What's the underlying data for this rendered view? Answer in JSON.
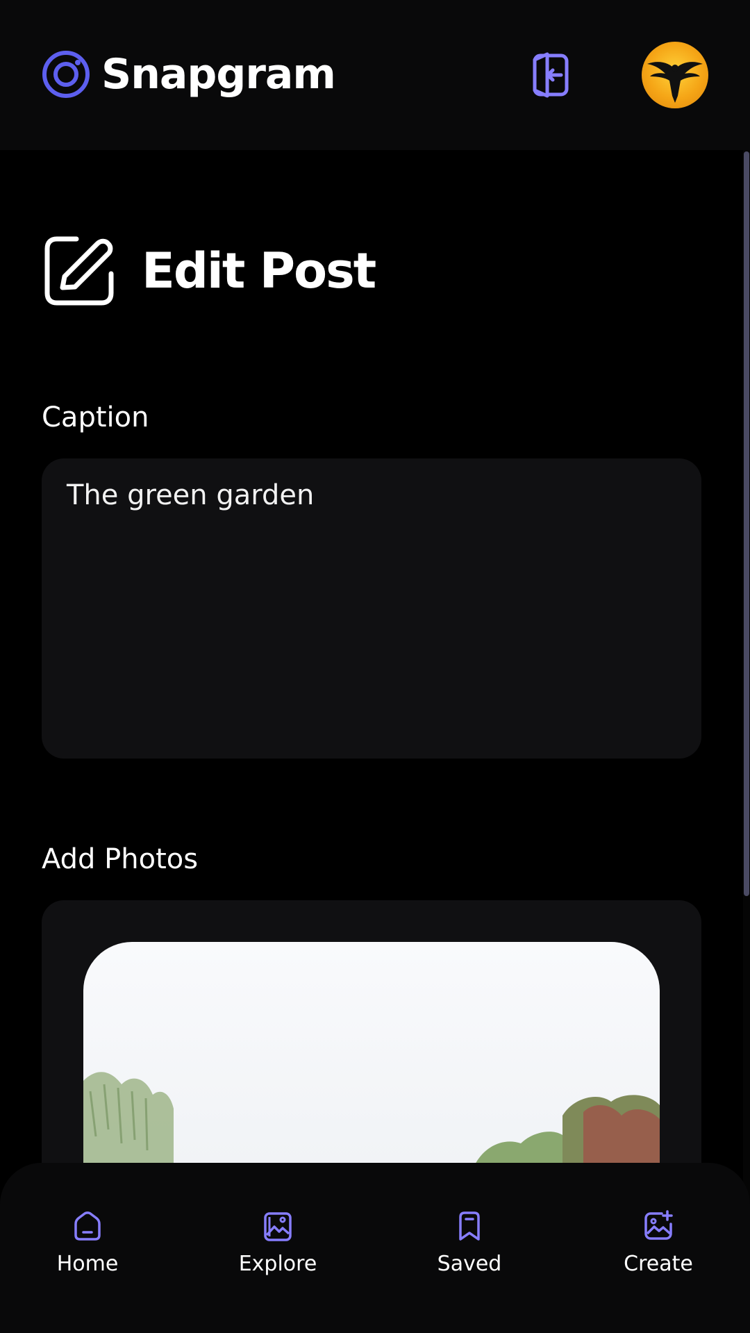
{
  "app": {
    "name": "Snapgram"
  },
  "header": {
    "logout_icon": "logout-icon",
    "avatar_icon": "eagle-avatar"
  },
  "page": {
    "title": "Edit Post",
    "title_icon": "edit-icon"
  },
  "form": {
    "caption_label": "Caption",
    "caption_value": "The green garden",
    "photos_label": "Add Photos"
  },
  "bottom_nav": [
    {
      "label": "Home",
      "icon": "home-icon"
    },
    {
      "label": "Explore",
      "icon": "explore-icon"
    },
    {
      "label": "Saved",
      "icon": "bookmark-icon"
    },
    {
      "label": "Create",
      "icon": "create-icon"
    }
  ],
  "colors": {
    "accent": "#877eff",
    "logo": "#5d5fef",
    "background": "#000000",
    "surface": "#101012"
  }
}
